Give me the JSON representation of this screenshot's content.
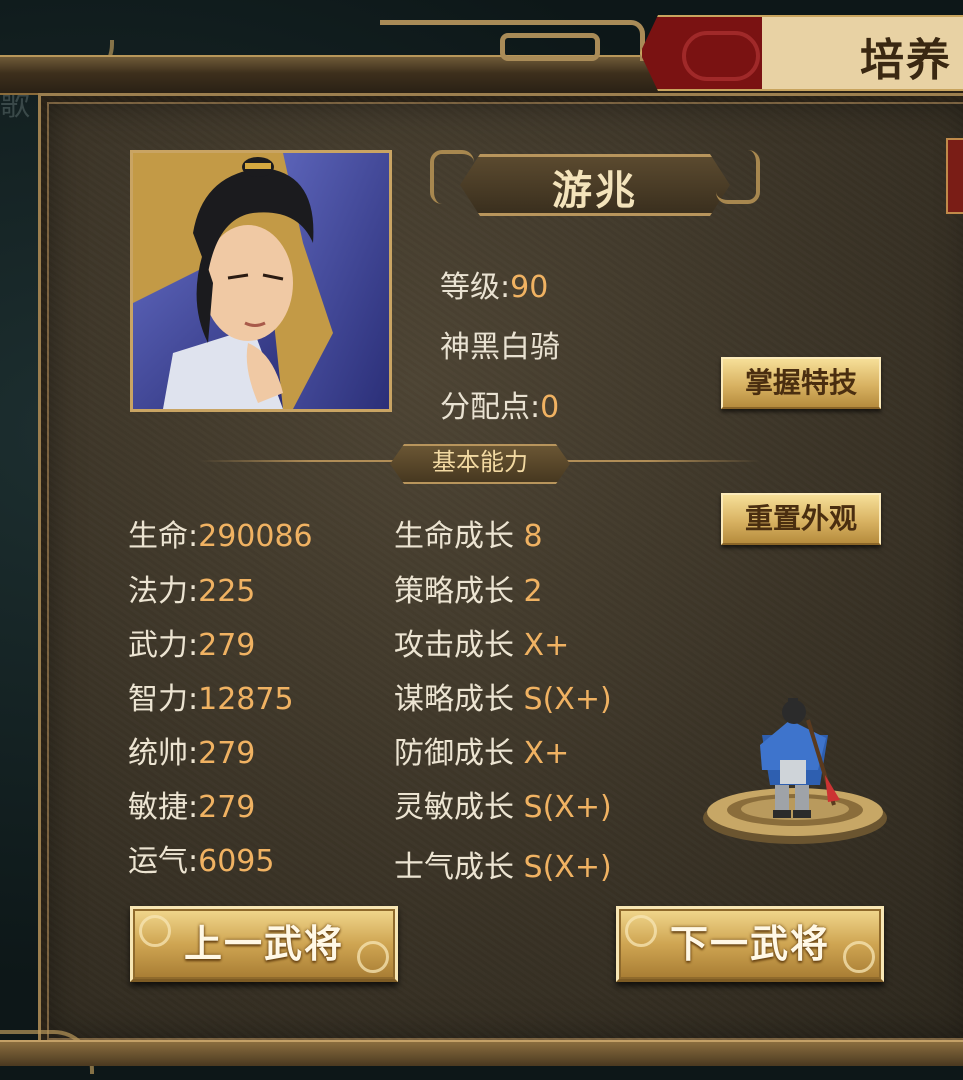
{
  "header": {
    "title": "培养",
    "background_hint": "歌"
  },
  "hero": {
    "name": "游兆",
    "level_label": "等级:",
    "level_value": "90",
    "unit_type": "神黑白骑",
    "points_label": "分配点:",
    "points_value": "0"
  },
  "buttons": {
    "master_skill": "掌握特技",
    "reset_appearance": "重置外观",
    "prev_general": "上一武将",
    "next_general": "下一武将"
  },
  "section": {
    "basic_abilities": "基本能力"
  },
  "stats": [
    {
      "label": "生命:",
      "value": "290086"
    },
    {
      "label": "法力:",
      "value": "225"
    },
    {
      "label": "武力:",
      "value": "279"
    },
    {
      "label": "智力:",
      "value": "12875"
    },
    {
      "label": "统帅:",
      "value": "279"
    },
    {
      "label": "敏捷:",
      "value": "279"
    },
    {
      "label": "运气:",
      "value": "6095"
    }
  ],
  "growth": [
    {
      "label": "生命成长",
      "value": "8"
    },
    {
      "label": "策略成长",
      "value": "2"
    },
    {
      "label": "攻击成长",
      "value": "X+"
    },
    {
      "label": "谋略成长",
      "value": "S(X+)"
    },
    {
      "label": "防御成长",
      "value": "X+"
    },
    {
      "label": "灵敏成长",
      "value": "S(X+)"
    },
    {
      "label": "士气成长",
      "value": "S(X+)"
    }
  ],
  "colors": {
    "value_orange": "#f0b262",
    "panel_brown": "#3a3326",
    "gold_border": "#c9a463",
    "ribbon_red": "#7a1212"
  }
}
